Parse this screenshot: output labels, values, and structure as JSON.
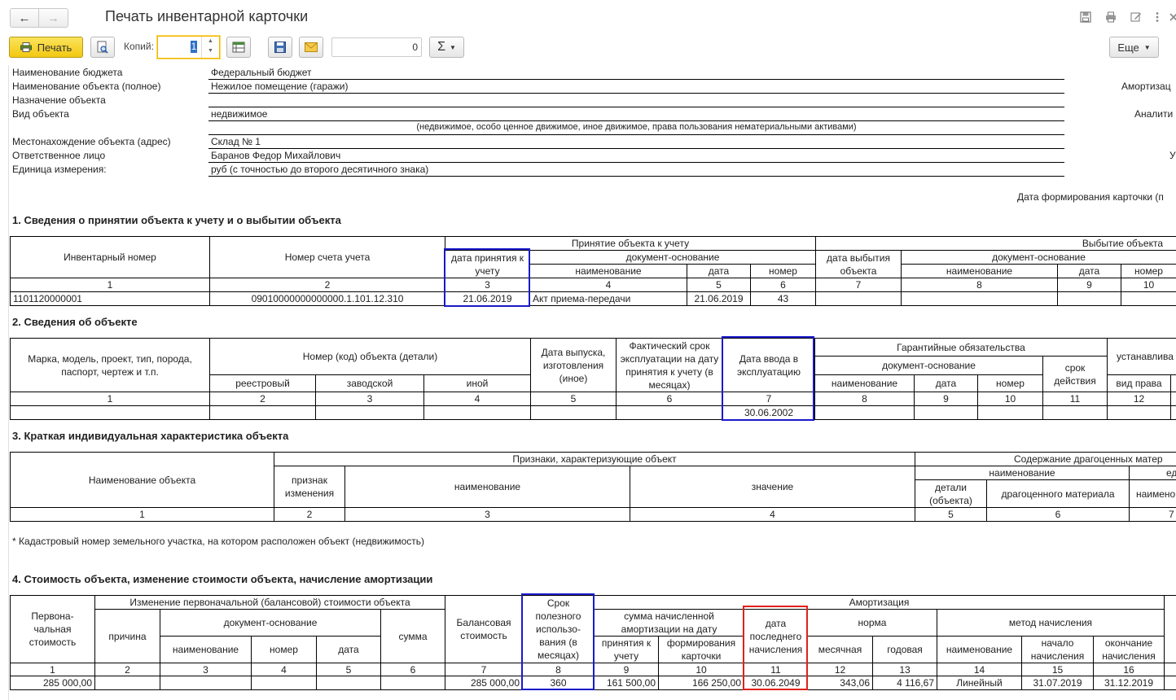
{
  "window": {
    "title": "Печать инвентарной карточки",
    "icons": [
      "save-icon",
      "printer-icon",
      "edit-icon",
      "more-vertical-icon",
      "close-icon"
    ]
  },
  "toolbar": {
    "print_label": "Печать",
    "copies_label": "Копий:",
    "copies_value": "1",
    "numeric_field_value": "0",
    "sum_label": "Σ",
    "more_label": "Еще"
  },
  "header": {
    "rows": [
      {
        "label": "Наименование бюджета",
        "value": "Федеральный бюджет"
      },
      {
        "label": "Наименование объекта (полное)",
        "value": "Нежилое помещение (гаражи)"
      },
      {
        "label": "Назначение объекта",
        "value": ""
      },
      {
        "label": "Вид объекта",
        "value": "недвижимое"
      },
      {
        "label": "",
        "value": "(недвижимое, особо ценное движимое, иное движимое, права пользования нематериальными активами)"
      },
      {
        "label": "Местонахождение объекта (адрес)",
        "value": "Склад № 1"
      },
      {
        "label": "Ответственное лицо",
        "value": "Баранов Федор Михайлович"
      },
      {
        "label": "Единица измерения:",
        "value": "руб (с точностью до второго десятичного знака)"
      }
    ],
    "right_amort": "Амортизац",
    "right_analit": "Аналити",
    "right_u": "У",
    "date_formed": "Дата формирования карточки (п"
  },
  "section1": {
    "title": "1. Сведения о принятии объекта к учету и о выбытии объекта",
    "h_inv": "Инвентарный номер",
    "h_account": "Номер счета учета",
    "h_accept": "Принятие объекта к учету",
    "h_accept_date": "дата принятия к учету",
    "h_doc": "документ-основание",
    "h_name": "наименование",
    "h_date": "дата",
    "h_number": "номер",
    "h_disposal": "Выбытие объекта",
    "h_disp_date": "дата выбытия объекта",
    "nums": [
      "1",
      "2",
      "3",
      "4",
      "5",
      "6",
      "7",
      "8",
      "9",
      "10"
    ],
    "row": [
      "1101120000001",
      "09010000000000000.1.101.12.310",
      "21.06.2019",
      "Акт приема-передачи",
      "21.06.2019",
      "43",
      "",
      "",
      "",
      ""
    ]
  },
  "section2": {
    "title": "2. Сведения об объекте",
    "h_brand": "Марка, модель, проект, тип, порода, паспорт, чертеж и т.п.",
    "h_code": "Номер (код) объекта (детали)",
    "h_reg": "реестровый",
    "h_factory": "заводской",
    "h_other": "иной",
    "h_release": "Дата выпуска, изготовления (иное)",
    "h_actual": "Фактический срок эксплуатации на дату принятия к учету (в месяцах)",
    "h_commission": "Дата ввода в эксплуатацию",
    "h_warranty": "Гарантийные обязательства",
    "h_doc": "документ-основание",
    "h_name": "наименование",
    "h_date": "дата",
    "h_number": "номер",
    "h_term": "срок действия",
    "h_installed": "устанавлива",
    "h_right": "вид права",
    "nums": [
      "1",
      "2",
      "3",
      "4",
      "5",
      "6",
      "7",
      "8",
      "9",
      "10",
      "11",
      "12"
    ],
    "commission_date": "30.06.2002"
  },
  "section3": {
    "title": "3. Краткая индивидуальная характеристика объекта",
    "h_objname": "Наименование объекта",
    "h_features": "Признаки, характеризующие объект",
    "h_change": "признак изменения",
    "h_fname": "наименование",
    "h_value": "значение",
    "h_precious": "Содержание драгоценных матер",
    "h_pname": "наименование",
    "h_parts": "детали (объекта)",
    "h_material": "драгоценного материала",
    "h_ed": "ед",
    "h_naimen": "наимено",
    "nums": [
      "1",
      "2",
      "3",
      "4",
      "5",
      "6",
      "7"
    ]
  },
  "note": "* Кадастровый номер земельного участка, на котором расположен объект (недвижимость)",
  "section4": {
    "title": "4. Стоимость объекта, изменение стоимости объекта, начисление амортизации",
    "h_initial": "Первона- чальная стоимость",
    "h_change": "Изменение первоначальной (балансовой) стоимости объекта",
    "h_reason": "причина",
    "h_doc": "документ-основание",
    "h_name": "наименование",
    "h_number": "номер",
    "h_date": "дата",
    "h_sum": "сумма",
    "h_balance": "Балансовая стоимость",
    "h_useful": "Срок полезного использо- вания (в месяцах)",
    "h_amort": "Амортизация",
    "h_accrued": "сумма начисленной амортизации на дату",
    "h_acceptance": "принятия к учету",
    "h_formation": "формирования карточки",
    "h_last": "дата последнего начисления",
    "h_norm": "норма",
    "h_monthly": "месячная",
    "h_yearly": "годовая",
    "h_method": "метод начисления",
    "h_mname": "наименование",
    "h_start": "начало начисления",
    "h_end": "окончание начисления",
    "nums": [
      "1",
      "2",
      "3",
      "4",
      "5",
      "6",
      "7",
      "8",
      "9",
      "10",
      "11",
      "12",
      "13",
      "14",
      "15",
      "16"
    ],
    "row": [
      "285 000,00",
      "",
      "",
      "",
      "",
      "",
      "285 000,00",
      "360",
      "161 500,00",
      "166 250,00",
      "30.06.2049",
      "343,06",
      "4 116,67",
      "Линейный",
      "31.07.2019",
      "31.12.2019"
    ]
  }
}
